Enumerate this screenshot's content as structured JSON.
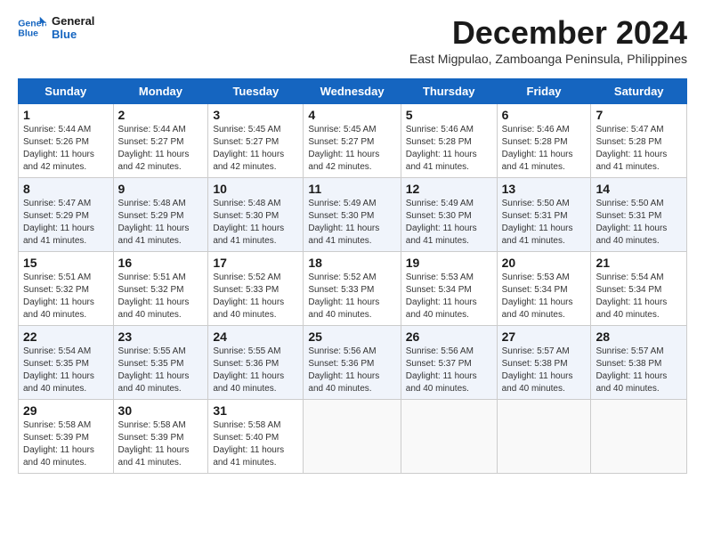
{
  "logo": {
    "line1": "General",
    "line2": "Blue"
  },
  "title": "December 2024",
  "subtitle": "East Migpulao, Zamboanga Peninsula, Philippines",
  "days_of_week": [
    "Sunday",
    "Monday",
    "Tuesday",
    "Wednesday",
    "Thursday",
    "Friday",
    "Saturday"
  ],
  "weeks": [
    [
      {
        "day": "1",
        "info": "Sunrise: 5:44 AM\nSunset: 5:26 PM\nDaylight: 11 hours\nand 42 minutes."
      },
      {
        "day": "2",
        "info": "Sunrise: 5:44 AM\nSunset: 5:27 PM\nDaylight: 11 hours\nand 42 minutes."
      },
      {
        "day": "3",
        "info": "Sunrise: 5:45 AM\nSunset: 5:27 PM\nDaylight: 11 hours\nand 42 minutes."
      },
      {
        "day": "4",
        "info": "Sunrise: 5:45 AM\nSunset: 5:27 PM\nDaylight: 11 hours\nand 42 minutes."
      },
      {
        "day": "5",
        "info": "Sunrise: 5:46 AM\nSunset: 5:28 PM\nDaylight: 11 hours\nand 41 minutes."
      },
      {
        "day": "6",
        "info": "Sunrise: 5:46 AM\nSunset: 5:28 PM\nDaylight: 11 hours\nand 41 minutes."
      },
      {
        "day": "7",
        "info": "Sunrise: 5:47 AM\nSunset: 5:28 PM\nDaylight: 11 hours\nand 41 minutes."
      }
    ],
    [
      {
        "day": "8",
        "info": "Sunrise: 5:47 AM\nSunset: 5:29 PM\nDaylight: 11 hours\nand 41 minutes."
      },
      {
        "day": "9",
        "info": "Sunrise: 5:48 AM\nSunset: 5:29 PM\nDaylight: 11 hours\nand 41 minutes."
      },
      {
        "day": "10",
        "info": "Sunrise: 5:48 AM\nSunset: 5:30 PM\nDaylight: 11 hours\nand 41 minutes."
      },
      {
        "day": "11",
        "info": "Sunrise: 5:49 AM\nSunset: 5:30 PM\nDaylight: 11 hours\nand 41 minutes."
      },
      {
        "day": "12",
        "info": "Sunrise: 5:49 AM\nSunset: 5:30 PM\nDaylight: 11 hours\nand 41 minutes."
      },
      {
        "day": "13",
        "info": "Sunrise: 5:50 AM\nSunset: 5:31 PM\nDaylight: 11 hours\nand 41 minutes."
      },
      {
        "day": "14",
        "info": "Sunrise: 5:50 AM\nSunset: 5:31 PM\nDaylight: 11 hours\nand 40 minutes."
      }
    ],
    [
      {
        "day": "15",
        "info": "Sunrise: 5:51 AM\nSunset: 5:32 PM\nDaylight: 11 hours\nand 40 minutes."
      },
      {
        "day": "16",
        "info": "Sunrise: 5:51 AM\nSunset: 5:32 PM\nDaylight: 11 hours\nand 40 minutes."
      },
      {
        "day": "17",
        "info": "Sunrise: 5:52 AM\nSunset: 5:33 PM\nDaylight: 11 hours\nand 40 minutes."
      },
      {
        "day": "18",
        "info": "Sunrise: 5:52 AM\nSunset: 5:33 PM\nDaylight: 11 hours\nand 40 minutes."
      },
      {
        "day": "19",
        "info": "Sunrise: 5:53 AM\nSunset: 5:34 PM\nDaylight: 11 hours\nand 40 minutes."
      },
      {
        "day": "20",
        "info": "Sunrise: 5:53 AM\nSunset: 5:34 PM\nDaylight: 11 hours\nand 40 minutes."
      },
      {
        "day": "21",
        "info": "Sunrise: 5:54 AM\nSunset: 5:34 PM\nDaylight: 11 hours\nand 40 minutes."
      }
    ],
    [
      {
        "day": "22",
        "info": "Sunrise: 5:54 AM\nSunset: 5:35 PM\nDaylight: 11 hours\nand 40 minutes."
      },
      {
        "day": "23",
        "info": "Sunrise: 5:55 AM\nSunset: 5:35 PM\nDaylight: 11 hours\nand 40 minutes."
      },
      {
        "day": "24",
        "info": "Sunrise: 5:55 AM\nSunset: 5:36 PM\nDaylight: 11 hours\nand 40 minutes."
      },
      {
        "day": "25",
        "info": "Sunrise: 5:56 AM\nSunset: 5:36 PM\nDaylight: 11 hours\nand 40 minutes."
      },
      {
        "day": "26",
        "info": "Sunrise: 5:56 AM\nSunset: 5:37 PM\nDaylight: 11 hours\nand 40 minutes."
      },
      {
        "day": "27",
        "info": "Sunrise: 5:57 AM\nSunset: 5:38 PM\nDaylight: 11 hours\nand 40 minutes."
      },
      {
        "day": "28",
        "info": "Sunrise: 5:57 AM\nSunset: 5:38 PM\nDaylight: 11 hours\nand 40 minutes."
      }
    ],
    [
      {
        "day": "29",
        "info": "Sunrise: 5:58 AM\nSunset: 5:39 PM\nDaylight: 11 hours\nand 40 minutes."
      },
      {
        "day": "30",
        "info": "Sunrise: 5:58 AM\nSunset: 5:39 PM\nDaylight: 11 hours\nand 41 minutes."
      },
      {
        "day": "31",
        "info": "Sunrise: 5:58 AM\nSunset: 5:40 PM\nDaylight: 11 hours\nand 41 minutes."
      },
      {
        "day": "",
        "info": ""
      },
      {
        "day": "",
        "info": ""
      },
      {
        "day": "",
        "info": ""
      },
      {
        "day": "",
        "info": ""
      }
    ]
  ]
}
